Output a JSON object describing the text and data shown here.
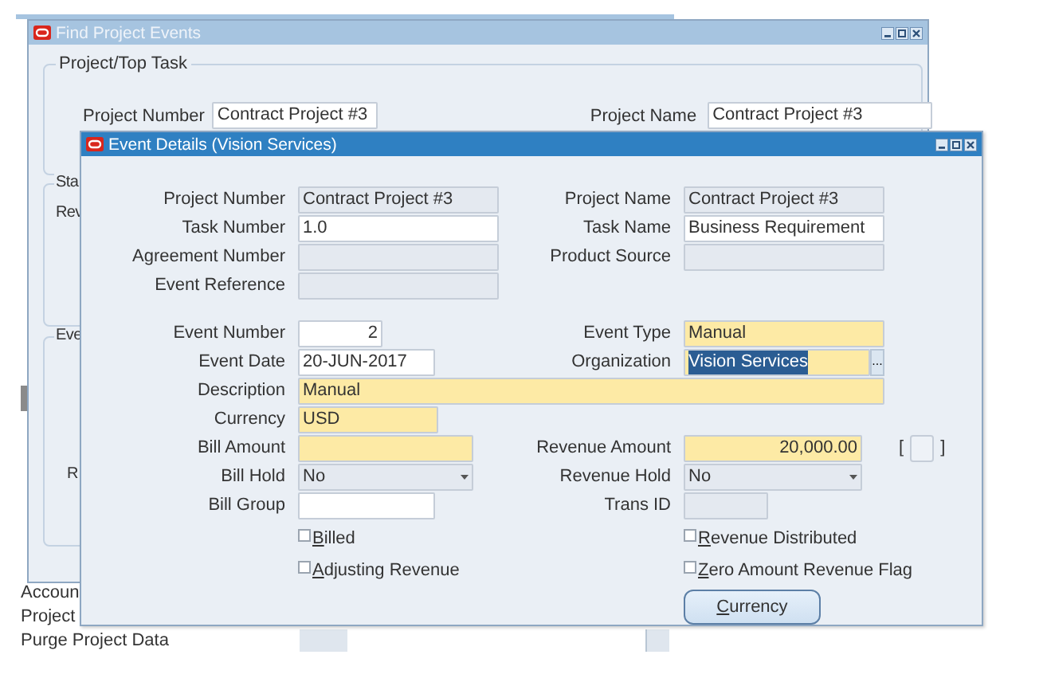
{
  "navigator": {
    "bottom_items": [
      "Accoun",
      "Project",
      "Purge Project Data"
    ]
  },
  "find_window": {
    "title": "Find Project Events",
    "active": false,
    "group": "Project/Top Task",
    "fields": [
      {
        "label": "Project Number",
        "value": "Contract Project #3"
      },
      {
        "label": "Project Name",
        "value": "Contract Project #3"
      }
    ],
    "cut_group_1": {
      "legend": "Sta",
      "label": "Rev"
    },
    "cut_group_2": {
      "legend": "Eve",
      "label": "R"
    }
  },
  "dialog": {
    "title": "Event Details (Vision Services)",
    "active": true,
    "rows": [
      {
        "left": {
          "kind": "disabled",
          "label": "Project Number",
          "value": "Contract Project #3"
        },
        "right": {
          "kind": "disabled",
          "label": "Project Name",
          "value": "Contract Project #3"
        }
      },
      {
        "left": {
          "kind": "text",
          "label": "Task Number",
          "value": "1.0"
        },
        "right": {
          "kind": "text",
          "label": "Task Name",
          "value": "Business Requirement"
        }
      },
      {
        "left": {
          "kind": "disabled",
          "label": "Agreement Number"
        },
        "right": {
          "kind": "disabled",
          "label": "Product Source"
        }
      },
      {
        "left": {
          "kind": "disabled",
          "label": "Event Reference"
        }
      },
      {
        "left": {
          "kind": "number",
          "label": "Event Number",
          "value": "2"
        },
        "right": {
          "kind": "required",
          "label": "Event Type",
          "value": "Manual"
        }
      },
      {
        "left": {
          "kind": "text",
          "label": "Event Date",
          "value": "20-JUN-2017"
        },
        "right": {
          "kind": "lov",
          "label": "Organization",
          "value": "Vision Services",
          "text_selected": true,
          "button": "..."
        }
      },
      {
        "left": {
          "kind": "required",
          "label": "Description",
          "value": "Manual"
        }
      },
      {
        "left": {
          "kind": "required",
          "label": "Currency",
          "value": "USD"
        }
      },
      {
        "left": {
          "kind": "required",
          "label": "Bill Amount"
        },
        "right": {
          "kind": "required_number",
          "label": "Revenue Amount",
          "value": "20,000.00",
          "flexfield": {
            "open": "[",
            "close": "]"
          }
        }
      },
      {
        "left": {
          "kind": "dropdown",
          "label": "Bill Hold",
          "value": "No"
        },
        "right": {
          "kind": "dropdown",
          "label": "Revenue Hold",
          "value": "No"
        }
      },
      {
        "left": {
          "kind": "text",
          "label": "Bill Group"
        },
        "right": {
          "kind": "disabled",
          "label": "Trans ID"
        }
      },
      {
        "left": {
          "kind": "checkbox",
          "label": "Billed",
          "checked": false
        },
        "right": {
          "kind": "checkbox",
          "label": "Revenue Distributed",
          "checked": false
        }
      },
      {
        "left": {
          "kind": "checkbox",
          "label": "Adjusting Revenue",
          "checked": false
        },
        "right": {
          "kind": "checkbox",
          "label": "Zero Amount Revenue Flag",
          "checked": false
        }
      },
      {
        "right": {
          "kind": "button",
          "label": "Currency"
        }
      }
    ]
  }
}
